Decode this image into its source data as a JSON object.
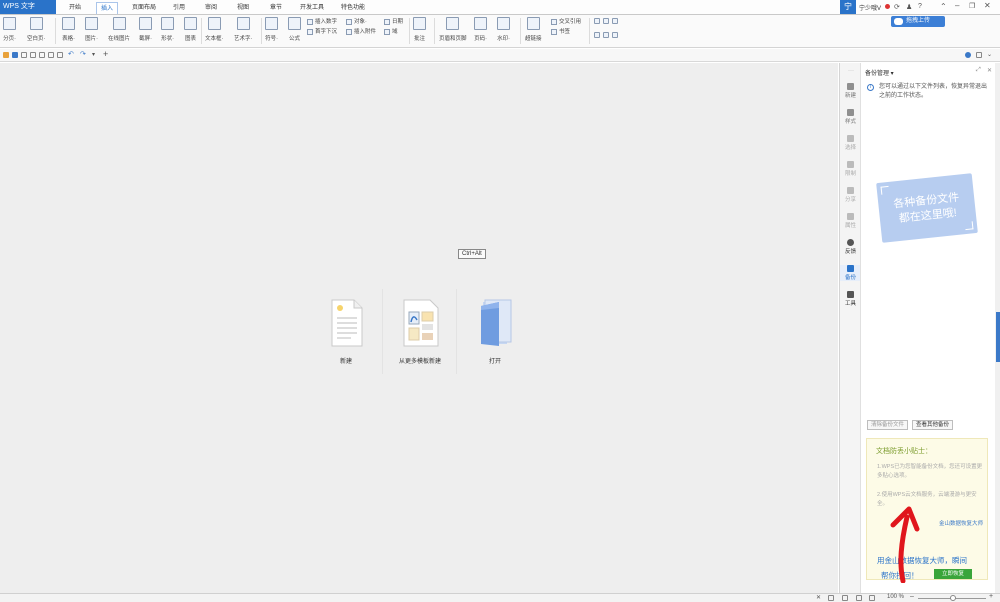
{
  "app": {
    "logo": "WPS 文字",
    "tabs": [
      "开始",
      "插入",
      "页面布局",
      "引用",
      "审阅",
      "视图",
      "章节",
      "开发工具",
      "特色功能"
    ],
    "active_tab": "插入",
    "user_name": "宁少哦V",
    "upload_label": "拖拽上传"
  },
  "ribbon": {
    "buttons": [
      {
        "label": "分页·"
      },
      {
        "label": "空白页·"
      },
      {
        "label": "表格·"
      },
      {
        "label": "图片·"
      },
      {
        "label": "在线图片"
      },
      {
        "label": "截屏·"
      },
      {
        "label": "形状·"
      },
      {
        "label": "图表"
      },
      {
        "label": "文本框·"
      },
      {
        "label": "艺术字·"
      },
      {
        "label": "符号·"
      },
      {
        "label": "公式"
      },
      {
        "label": "批注"
      },
      {
        "label": "页眉和页脚"
      },
      {
        "label": "页码·"
      },
      {
        "label": "水印·"
      },
      {
        "label": "超链接"
      }
    ],
    "small": [
      "插入数字",
      "对象·",
      "日期",
      "首字下沉",
      "插入附件",
      "域",
      "交叉引用",
      "书签"
    ]
  },
  "document": {
    "tooltip": "Ctrl+Alt",
    "cards": [
      {
        "label": "新建"
      },
      {
        "label": "从更多模板新建"
      },
      {
        "label": "打开"
      }
    ]
  },
  "sidebar": {
    "items": [
      {
        "label": "新建"
      },
      {
        "label": "样式"
      },
      {
        "label": "选择"
      },
      {
        "label": "限制"
      },
      {
        "label": "分享"
      },
      {
        "label": "属性"
      },
      {
        "label": "反馈"
      },
      {
        "label": "备份"
      },
      {
        "label": "工具"
      }
    ],
    "active": "备份"
  },
  "panel": {
    "title": "备份管理",
    "info": "您可以通过以下文件列表，恢复异常退出之前的工作状态。",
    "placeholder_line1": "各种备份文件",
    "placeholder_line2": "都在这里哦!",
    "clear_btn": "清除备份文件",
    "view_btn": "查看其他备份",
    "tips_title": "文档防丢小贴士：",
    "tip1": "1.WPS已为您智能备份文档，您还可设置更多贴心选项。",
    "tip2": "2.使用WPS云文档服务，云端漫游与更安全。",
    "promo_link": "金山数据恢复大师",
    "promo_line1": "用金山数据恢复大师，瞬间",
    "promo_line2": "帮你找回！",
    "restore_btn": "立即恢复"
  },
  "status": {
    "zoom": "100 %"
  },
  "colors": {
    "accent": "#2a73c9",
    "panel_card": "#b7cdf0",
    "tip_bg": "#fdfbe7",
    "restore_green": "#3aa53a",
    "arrow_red": "#e0161c"
  }
}
